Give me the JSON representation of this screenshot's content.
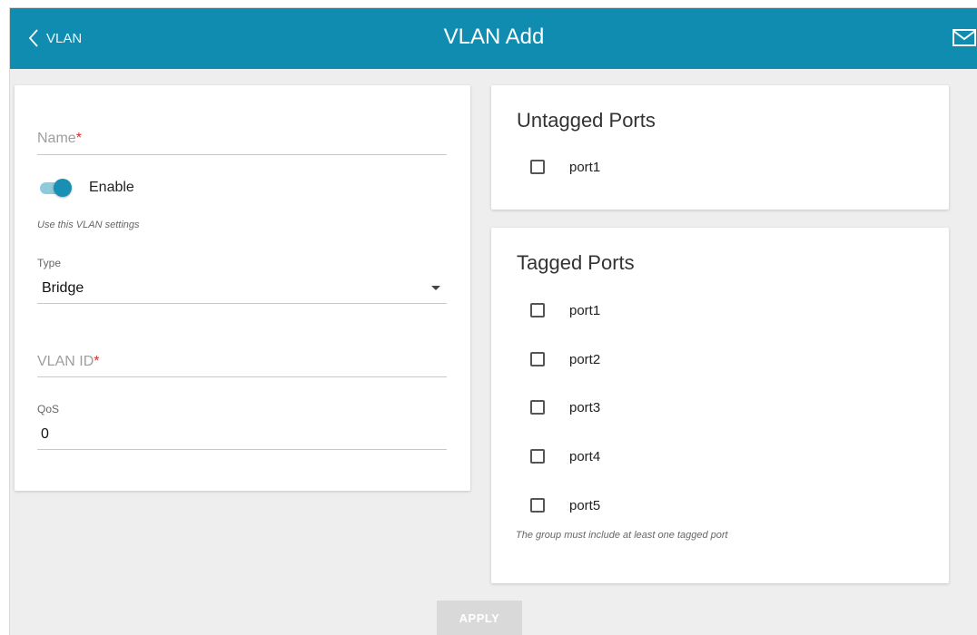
{
  "header": {
    "back_label": "VLAN",
    "title": "VLAN Add",
    "icons": {
      "back": "chevron-left-icon",
      "mail": "mail-icon"
    }
  },
  "form": {
    "name": {
      "placeholder": "Name",
      "required_mark": "*",
      "value": ""
    },
    "enable": {
      "label": "Enable",
      "checked": true,
      "hint": "Use this VLAN settings"
    },
    "type": {
      "label": "Type",
      "value": "Bridge"
    },
    "vlan_id": {
      "placeholder": "VLAN ID",
      "required_mark": "*",
      "value": ""
    },
    "qos": {
      "label": "QoS",
      "value": "0"
    }
  },
  "untagged": {
    "title": "Untagged Ports",
    "ports": [
      {
        "label": "port1",
        "checked": false
      }
    ]
  },
  "tagged": {
    "title": "Tagged Ports",
    "ports": [
      {
        "label": "port1",
        "checked": false
      },
      {
        "label": "port2",
        "checked": false
      },
      {
        "label": "port3",
        "checked": false
      },
      {
        "label": "port4",
        "checked": false
      },
      {
        "label": "port5",
        "checked": false
      }
    ],
    "hint": "The group must include at least one tagged port"
  },
  "actions": {
    "apply_label": "APPLY"
  },
  "colors": {
    "accent": "#0f8cb0",
    "required": "#d32f2f",
    "background": "#eeeeee"
  }
}
